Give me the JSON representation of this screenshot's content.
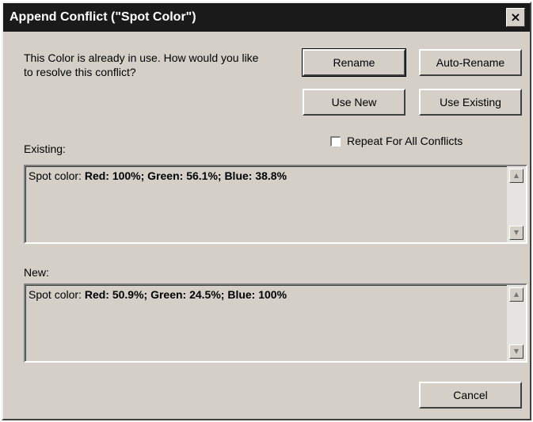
{
  "window": {
    "title": "Append Conflict (\"Spot Color\")",
    "close_glyph": "×"
  },
  "message": "This Color is already in use. How would you like to resolve this conflict?",
  "buttons": {
    "rename": "Rename",
    "auto_rename": "Auto-Rename",
    "use_new": "Use New",
    "use_existing": "Use Existing",
    "cancel": "Cancel"
  },
  "repeat_checkbox": {
    "label": "Repeat For All Conflicts",
    "checked": false
  },
  "existing": {
    "label": "Existing:",
    "prefix": "Spot color: ",
    "detail": "Red: 100%; Green: 56.1%; Blue: 38.8%"
  },
  "new": {
    "label": "New:",
    "prefix": "Spot color: ",
    "detail": "Red: 50.9%; Green: 24.5%; Blue: 100%"
  },
  "icons": {
    "scroll_up": "▲",
    "scroll_down": "▼"
  }
}
